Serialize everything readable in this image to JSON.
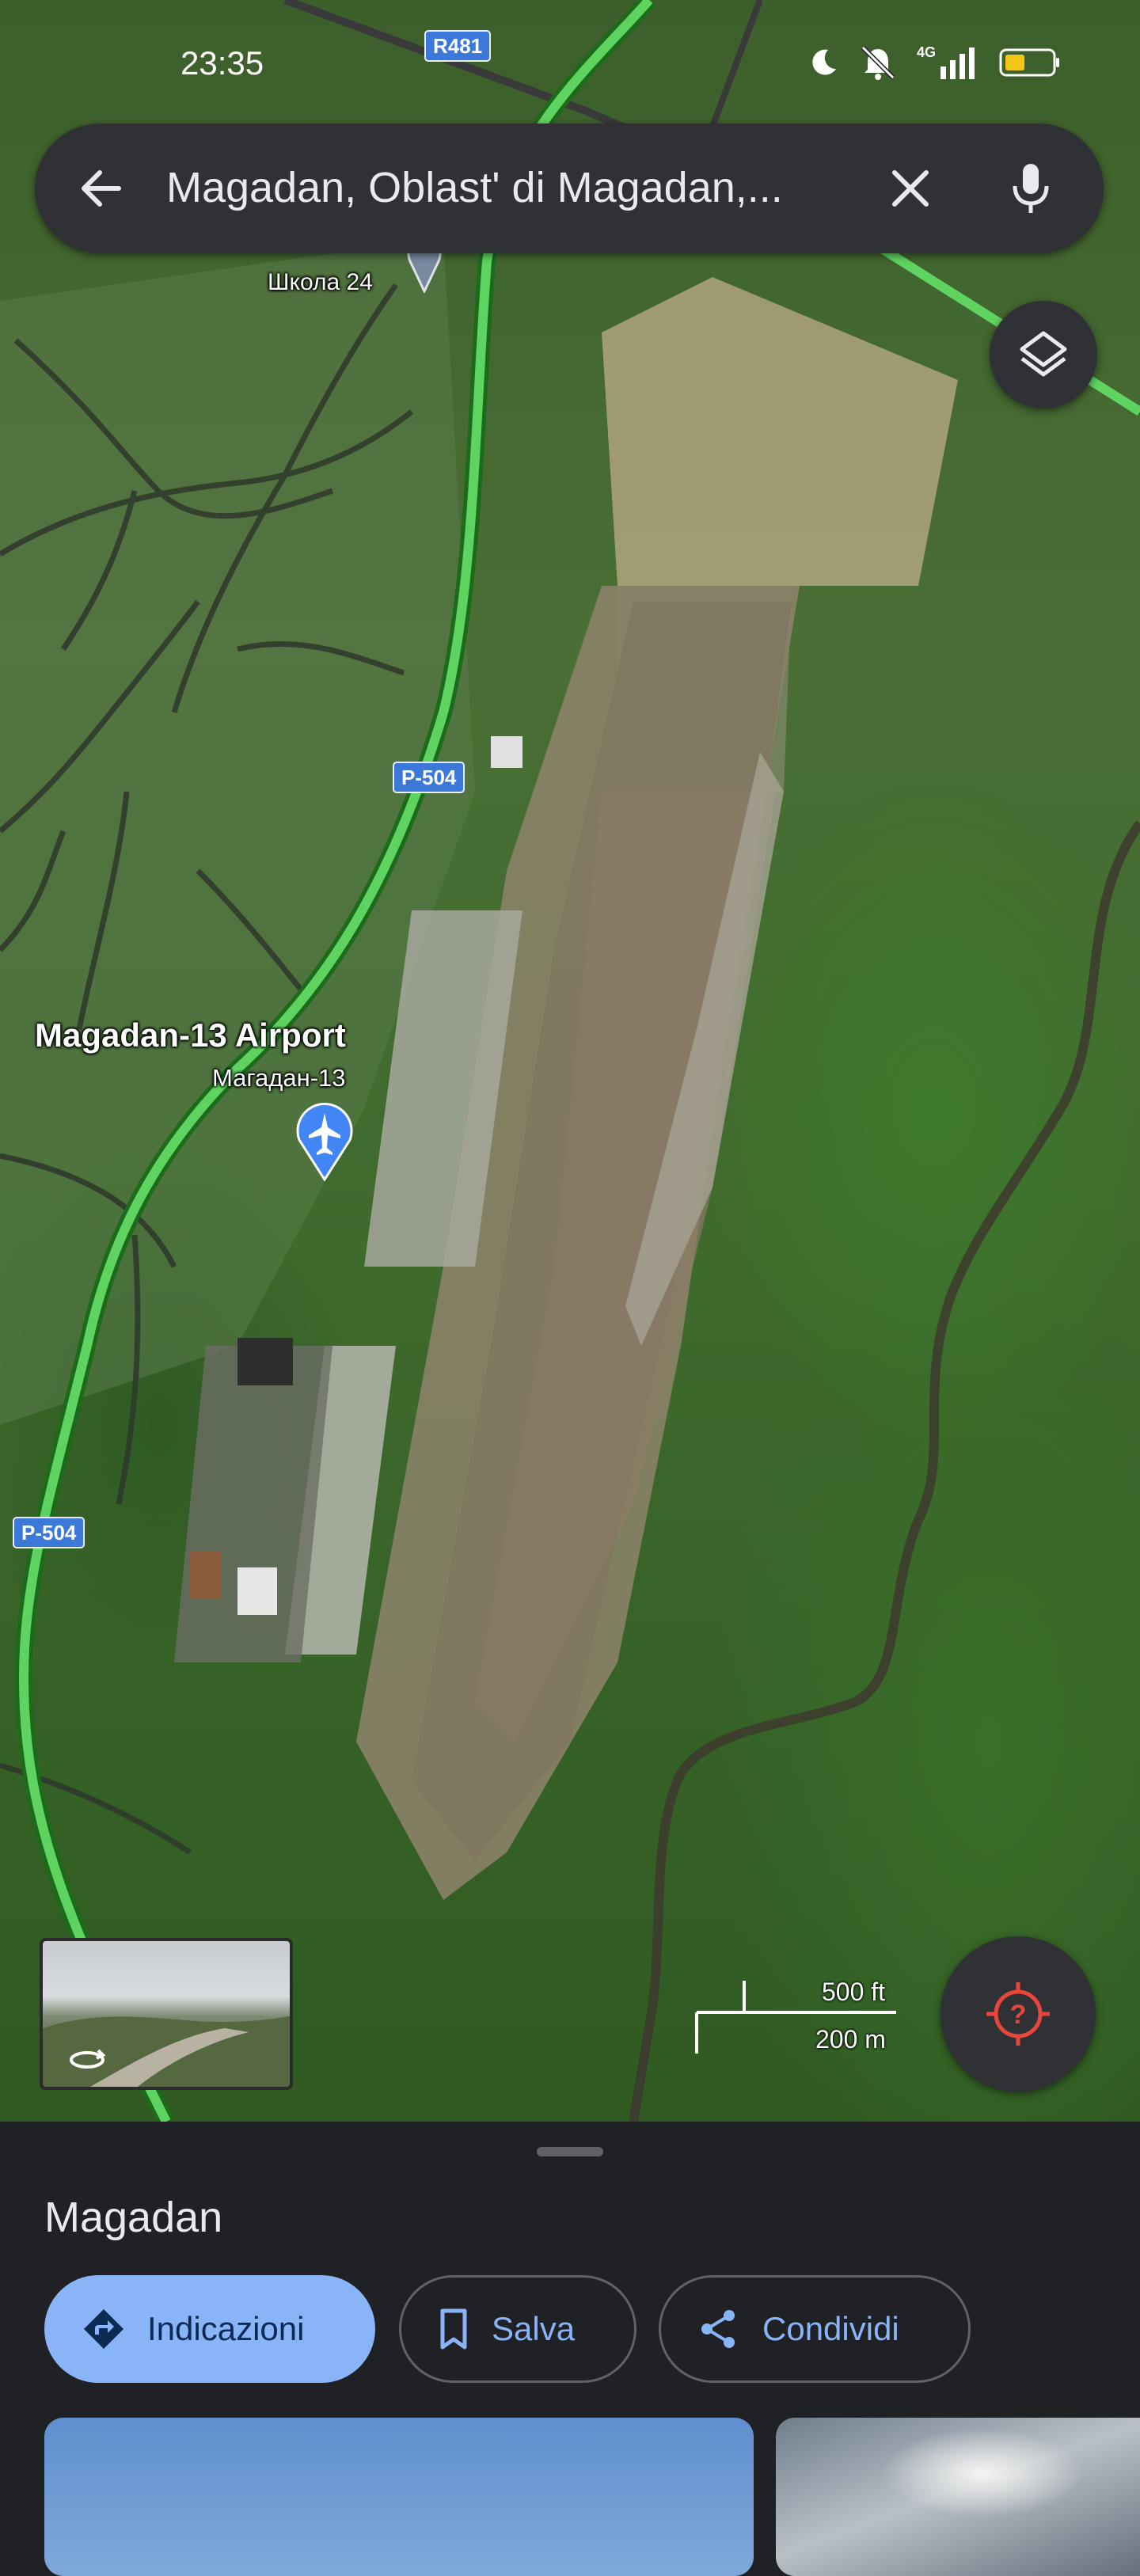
{
  "status_bar": {
    "time": "23:35",
    "network": "4G",
    "icons": [
      "moon-icon",
      "muted-bell-icon",
      "signal-icon",
      "battery-icon"
    ],
    "battery_color": "#f5c518"
  },
  "search": {
    "query": "Magadan, Oblast' di Magadan,...",
    "back_icon": "arrow-back-icon",
    "clear_icon": "close-icon",
    "voice_icon": "microphone-icon"
  },
  "map": {
    "road_labels": {
      "r481": "R481",
      "p504_top": "Р-504",
      "p504_bottom": "Р-504"
    },
    "place_labels": {
      "school": "Школа 24",
      "airport_name": "Magadan-13 Airport",
      "airport_local": "Магадан-13"
    },
    "scale": {
      "imperial": "500 ft",
      "metric": "200 m"
    },
    "colors": {
      "highway": "#5fd35f",
      "road": "#3a3a3a",
      "accent_pin": "#4285f4",
      "location_icon": "#e8453c"
    }
  },
  "controls": {
    "layers_icon": "layers-icon",
    "location_icon": "location-unknown-icon",
    "street_view_icon": "rotate-360-icon"
  },
  "sheet": {
    "title": "Magadan",
    "actions": {
      "directions": "Indicazioni",
      "save": "Salva",
      "share": "Condividi"
    }
  }
}
